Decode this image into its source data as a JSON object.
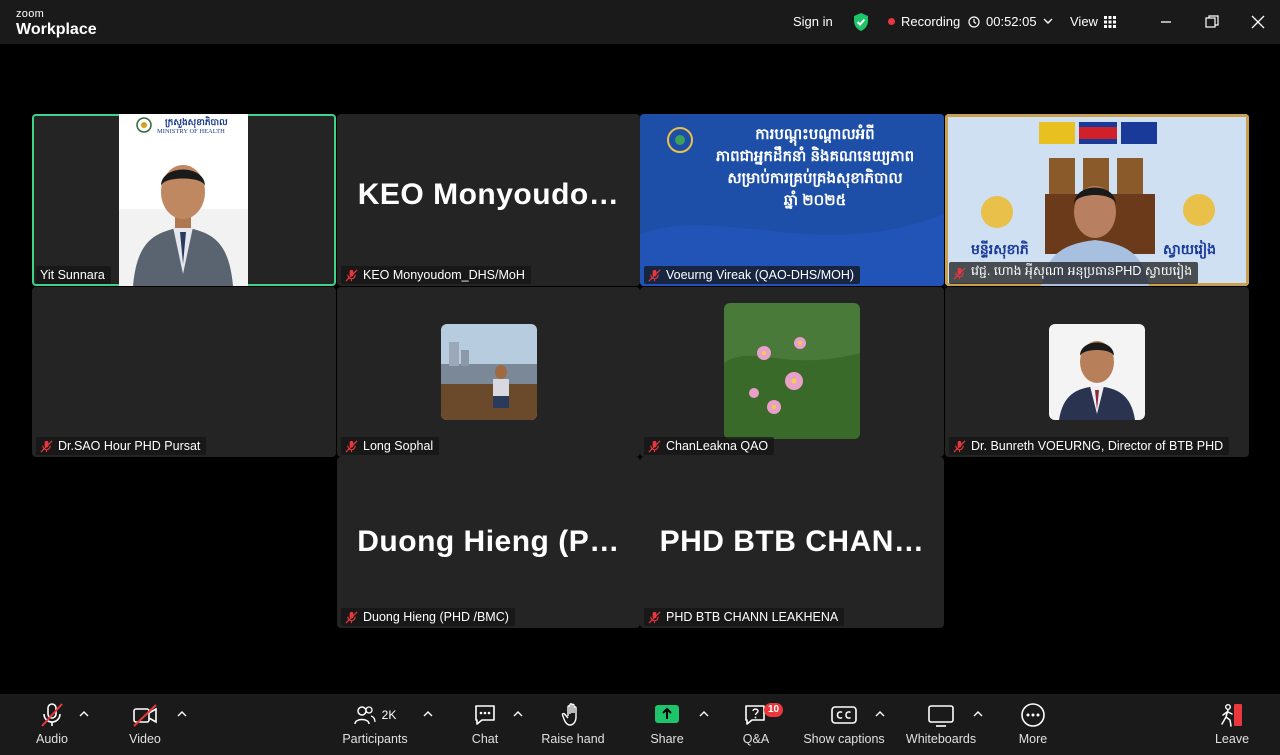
{
  "app": {
    "brand_top": "zoom",
    "brand_bottom": "Workplace"
  },
  "titlebar": {
    "sign_in": "Sign in",
    "recording": "Recording",
    "timer": "00:52:05",
    "view": "View"
  },
  "tiles": {
    "t1": {
      "name": "Yit Sunnara",
      "logo_kh": "ក្រសួងសុខាភិបាល",
      "logo_en": "MINISTRY OF HEALTH"
    },
    "t2": {
      "name": "KEO Monyoudom_DHS/MoH",
      "big": "KEO  Monyoudo…"
    },
    "t3": {
      "name": "Voeurng Vireak (QAO-DHS/MOH)",
      "slide_l1": "ការបណ្តុះបណ្តាលអំពី",
      "slide_l2": "ភាពជាអ្នកដឹកនាំ និងគណនេយ្យភាព",
      "slide_l3": "សម្រាប់ការគ្រប់គ្រងសុខាភិបាល",
      "slide_l4": "ឆ្នាំ ២០២៥"
    },
    "t4": {
      "name": "វេជ្ជ. ហោង អុីសុណា អនុប្រធានPHD ស្វាយរៀង",
      "banner": "មន្ទីរសុខាភិ",
      "banner_r": "ស្វាយរៀង"
    },
    "t5": {
      "name": "Dr.SAO Hour PHD Pursat"
    },
    "t6": {
      "name": "Long Sophal"
    },
    "t7": {
      "name": "ChanLeakna QAO"
    },
    "t8": {
      "name": "Dr. Bunreth VOEURNG, Director of BTB PHD"
    },
    "t9": {
      "name": "Duong Hieng (PHD /BMC)",
      "big": "Duong  Hieng  (P…"
    },
    "t10": {
      "name": "PHD BTB CHANN LEAKHENA",
      "big": "PHD  BTB  CHAN…"
    }
  },
  "toolbar": {
    "audio": "Audio",
    "video": "Video",
    "participants": "Participants",
    "participants_count": "2K",
    "chat": "Chat",
    "raise_hand": "Raise hand",
    "share": "Share",
    "qa": "Q&A",
    "qa_badge": "10",
    "captions": "Show captions",
    "whiteboards": "Whiteboards",
    "more": "More",
    "leave": "Leave"
  },
  "colors": {
    "active_speaker": "#3ed28a",
    "record": "#e8383d",
    "share": "#1ec46a",
    "badge": "#e8383d"
  }
}
